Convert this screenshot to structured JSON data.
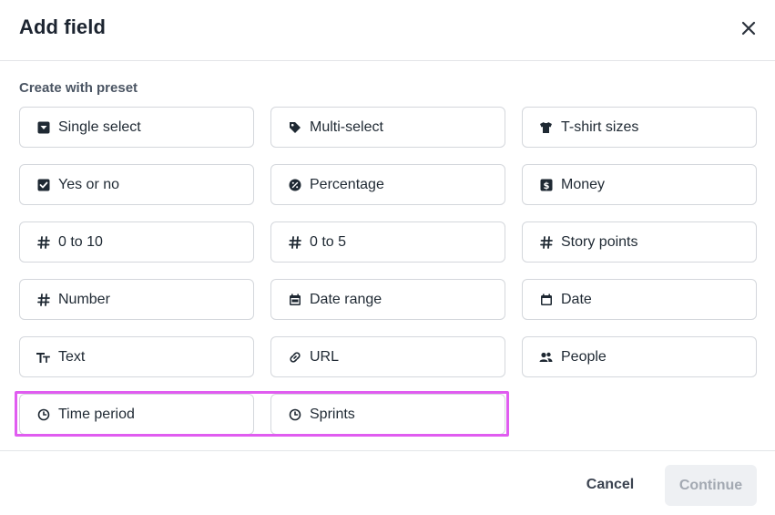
{
  "dialog": {
    "title": "Add field",
    "close_icon": "close-icon"
  },
  "section_label": "Create with preset",
  "presets": [
    {
      "label": "Single select",
      "icon": "single-select-icon"
    },
    {
      "label": "Multi-select",
      "icon": "tag-icon"
    },
    {
      "label": "T-shirt sizes",
      "icon": "tshirt-icon"
    },
    {
      "label": "Yes or no",
      "icon": "checkbox-icon"
    },
    {
      "label": "Percentage",
      "icon": "percentage-icon"
    },
    {
      "label": "Money",
      "icon": "dollar-icon"
    },
    {
      "label": "0 to 10",
      "icon": "hash-icon"
    },
    {
      "label": "0 to 5",
      "icon": "hash-icon"
    },
    {
      "label": "Story points",
      "icon": "hash-icon"
    },
    {
      "label": "Number",
      "icon": "hash-icon"
    },
    {
      "label": "Date range",
      "icon": "calendar-range-icon"
    },
    {
      "label": "Date",
      "icon": "calendar-icon"
    },
    {
      "label": "Text",
      "icon": "text-icon"
    },
    {
      "label": "URL",
      "icon": "link-icon"
    },
    {
      "label": "People",
      "icon": "people-icon"
    },
    {
      "label": "Time period",
      "icon": "clock-icon"
    },
    {
      "label": "Sprints",
      "icon": "clock-icon"
    }
  ],
  "footer": {
    "cancel_label": "Cancel",
    "continue_label": "Continue"
  },
  "colors": {
    "highlight": "#e05cf0",
    "border": "#d4d7dc",
    "continue_disabled_bg": "#eef0f3",
    "continue_disabled_text": "#a3a9b2"
  }
}
